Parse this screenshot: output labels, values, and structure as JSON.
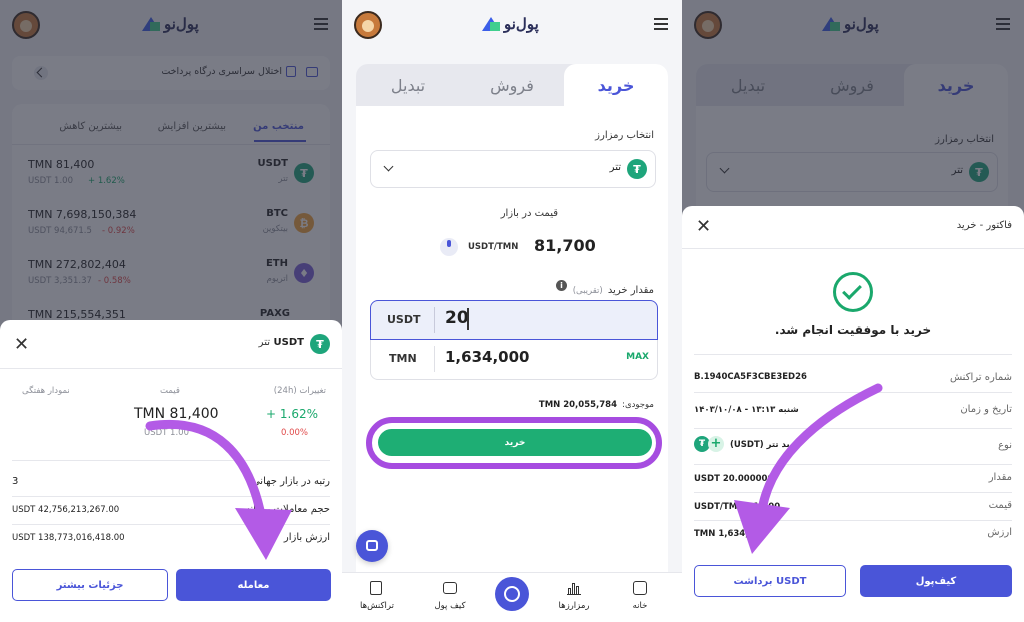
{
  "brand": {
    "logo_text": "پول‌نو"
  },
  "panel1": {
    "notice": "اختلال سراسری درگاه پرداخت",
    "tabs": [
      "منتخب من",
      "بیشترین افزایش",
      "بیشترین کاهش"
    ],
    "rows": [
      {
        "symbol": "USDT",
        "name": "تتر",
        "price": "TMN 81,400",
        "sub": "USDT 1.00",
        "change": "+ 1.62%",
        "dir": "up",
        "coin": "₮"
      },
      {
        "symbol": "BTC",
        "name": "بیتکوین",
        "price": "TMN 7,698,150,384",
        "sub": "USDT 94,671.5",
        "change": "- 0.92%",
        "dir": "down",
        "coin": "₿"
      },
      {
        "symbol": "ETH",
        "name": "اتریوم",
        "price": "TMN 272,802,404",
        "sub": "USDT 3,351.37",
        "change": "- 0.58%",
        "dir": "down",
        "coin": "♦"
      },
      {
        "symbol": "PAXG",
        "name": "",
        "price": "TMN 215,554,351",
        "sub": "",
        "change": "",
        "dir": "none",
        "coin": ""
      }
    ],
    "sheet": {
      "symbol": "USDT",
      "name": "تتر",
      "col_change": "تغییرات (24h)",
      "col_price": "قیمت",
      "col_chart": "نمودار هفتگی",
      "change_up": "+ 1.62%",
      "change_zero": "0.00%",
      "price": "TMN 81,400",
      "price_sub": "USDT 1.00",
      "stats": [
        {
          "label": "رتبه در بازار جهانی",
          "value": "3"
        },
        {
          "label": "حجم معاملات روزانه",
          "value": "USDT 42,756,213,267.00"
        },
        {
          "label": "ارزش بازار",
          "value": "USDT 138,773,016,418.00"
        }
      ],
      "trade_button": "معامله",
      "details_button": "جزئیات بیشتر"
    }
  },
  "panel2": {
    "tabs": {
      "buy": "خرید",
      "sell": "فروش",
      "swap": "تبدیل"
    },
    "select_label": "انتخاب رمزارز",
    "selected_coin": "تتر",
    "market_price_label": "قیمت در بازار",
    "market_price_value": "81,700",
    "market_price_unit": "USDT/TMN",
    "amount_label": "مقدار خرید",
    "amount_hint": "(تقریبی)",
    "input_usdt_unit": "USDT",
    "input_usdt_value": "20",
    "input_tmn_unit": "TMN",
    "input_tmn_value": "1,634,000",
    "max_label": "MAX",
    "balance_label": "موجودی:",
    "balance_value": "TMN 20,055,784",
    "buy_button": "خرید",
    "nav": [
      {
        "label": "خانه",
        "icon": "home-icon"
      },
      {
        "label": "رمزارزها",
        "icon": "chart-bars-icon"
      },
      {
        "label": "",
        "icon": "exchange-icon"
      },
      {
        "label": "کیف پول",
        "icon": "wallet-icon"
      },
      {
        "label": "تراکنش‌ها",
        "icon": "transactions-icon"
      }
    ]
  },
  "panel3": {
    "tabs": {
      "buy": "خرید",
      "sell": "فروش",
      "swap": "تبدیل"
    },
    "select_label": "انتخاب رمزارز",
    "selected_coin": "تتر",
    "invoice_title": "فاکتور - خرید",
    "success_text": "خرید با موفقیت انجام شد.",
    "rows": [
      {
        "label": "شماره تراکنش",
        "value": "B.1940CA5F3CBE3ED26"
      },
      {
        "label": "تاریخ و زمان",
        "value": "شنبه ۱۳:۱۳ - ۱۴۰۳/۱۰/۰۸"
      },
      {
        "label": "نوع",
        "value": "خرید تتر (USDT)"
      },
      {
        "label": "مقدار",
        "value": "USDT 20.000000"
      },
      {
        "label": "قیمت",
        "value": "USDT/TMN 81,700"
      },
      {
        "label": "ارزش",
        "value": "TMN 1,634,000"
      }
    ],
    "wallet_button": "کیف‌پول",
    "withdraw_button": "برداشت USDT"
  },
  "colors": {
    "primary": "#4a55d8",
    "green": "#1aa86c",
    "red": "#e04848",
    "highlight": "#a64ce0",
    "arrow": "#b35be6"
  }
}
